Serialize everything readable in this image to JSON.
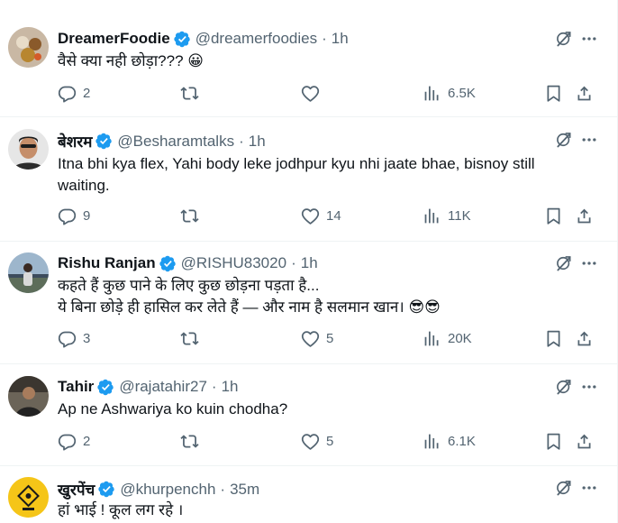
{
  "tweets": [
    {
      "name": "DreamerFoodie",
      "handle": "@dreamerfoodies",
      "time": "1h",
      "text": "वैसे क्या नही छोड़ा??? 😀",
      "replies": "2",
      "retweets": "",
      "likes": "",
      "views": "6.5K",
      "avatar_color": "#c9b8a4"
    },
    {
      "name": "बेशरम",
      "handle": "@Besharamtalks",
      "time": "1h",
      "text": "Itna bhi kya flex, Yahi body leke jodhpur kyu nhi jaate bhae, bisnoy still waiting.",
      "replies": "9",
      "retweets": "",
      "likes": "14",
      "views": "11K",
      "avatar_color": "#2b2b2b"
    },
    {
      "name": "Rishu Ranjan",
      "handle": "@RISHU83020",
      "time": "1h",
      "text": "कहते हैं कुछ पाने के लिए कुछ छोड़ना पड़ता है...\nये बिना छोड़े ही हासिल कर लेते हैं — और नाम है सलमान खान। 😎😎",
      "replies": "3",
      "retweets": "",
      "likes": "5",
      "views": "20K",
      "avatar_color": "#6e8aa6"
    },
    {
      "name": "Tahir",
      "handle": "@rajatahir27",
      "time": "1h",
      "text": "Ap ne Ashwariya ko kuin chodha?",
      "replies": "2",
      "retweets": "",
      "likes": "5",
      "views": "6.1K",
      "avatar_color": "#4a4a4a"
    },
    {
      "name": "खुरपेंच",
      "handle": "@khurpenchh",
      "time": "35m",
      "text": "हां भाई ! कूल लग रहे ।",
      "replies": "",
      "retweets": "",
      "likes": "",
      "views": "",
      "avatar_color": "#f5c518"
    }
  ],
  "dot_separator": "·",
  "colors": {
    "verified_blue": "#1d9bf0",
    "icon_gray": "#536471",
    "text": "#0f1419",
    "divider": "#eff3f4"
  },
  "icons": [
    "verified-badge-icon",
    "grok-icon",
    "more-icon",
    "reply-icon",
    "retweet-icon",
    "like-icon",
    "views-icon",
    "bookmark-icon",
    "share-icon"
  ]
}
